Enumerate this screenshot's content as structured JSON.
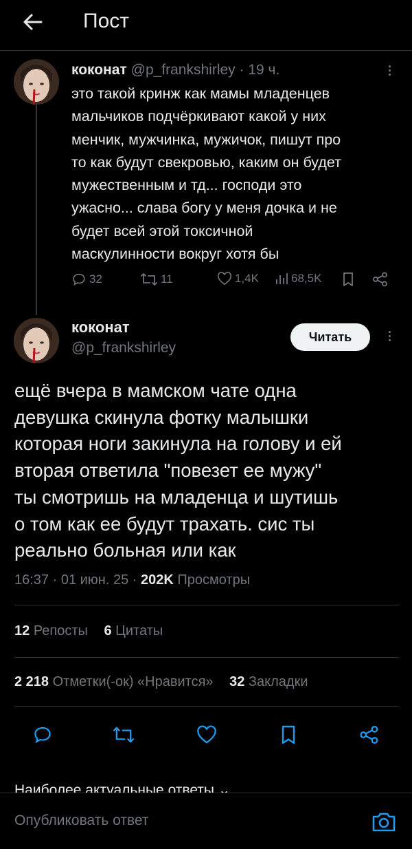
{
  "header": {
    "title": "Пост"
  },
  "reply": {
    "name": "коконат",
    "handle": "@p_frankshirley",
    "time": "· 19 ч.",
    "text": "это такой кринж как мамы младенцев\nмальчиков подчёркивают какой у них\nменчик, мужчинка, мужичок, пишут про\nто как будут свекровью, каким он будет\nмужественным и тд... господи это\nужасно... слава богу у меня дочка и не\nбудет всей этой токсичной\nмаскулинности вокруг хотя бы",
    "replies": "32",
    "reposts": "11",
    "likes": "1,4K",
    "views": "68,5K"
  },
  "post": {
    "name": "коконат",
    "handle": "@p_frankshirley",
    "follow_label": "Читать",
    "text": "ещё вчера в мамском чате одна\nдевушка скинула фотку малышки\nкоторая ноги закинула на голову и ей\nвторая ответила \"повезет ее мужу\"\nты смотришь на младенца и шутишь\nо том как ее будут трахать. сис ты\nреально больная или как",
    "time": "16:37 · 01 июн. 25 ·",
    "views_count": "202K",
    "views_label": "Просмотры"
  },
  "stats": {
    "reposts_count": "12",
    "reposts_label": "Репосты",
    "quotes_count": "6",
    "quotes_label": "Цитаты",
    "likes_count": "2 218",
    "likes_label": "Отметки(-ок) «Нравится»",
    "bookmarks_count": "32",
    "bookmarks_label": "Закладки"
  },
  "replies_sort": {
    "label": "Наиболее актуальные ответы ⌄"
  },
  "composer": {
    "placeholder": "Опубликовать ответ"
  },
  "colors": {
    "accent": "#1d9bf0",
    "muted": "#71767b",
    "text": "#e7e9ea",
    "background": "#000000",
    "divider": "#2f3336"
  }
}
